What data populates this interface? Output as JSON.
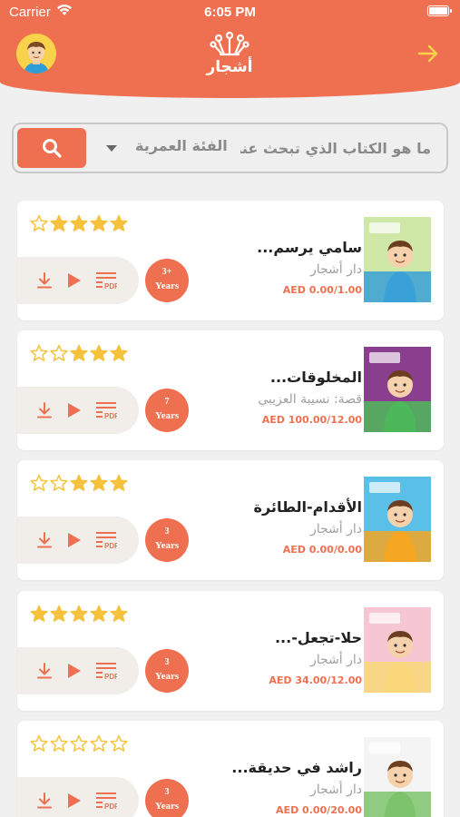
{
  "status": {
    "carrier": "Carrier",
    "time": "6:05 PM"
  },
  "header": {
    "logo_text": "أشجار"
  },
  "search": {
    "placeholder": "ما هو الكتاب الذي تبحث عنه",
    "age_filter_label": "الفئة العمرية"
  },
  "colors": {
    "accent": "#ef7050",
    "star": "#f6c23e",
    "price": "#ef7050"
  },
  "books": [
    {
      "title": "سامي يرسم...",
      "author": "دار أشجار",
      "price": "AED 0.00/1.00",
      "age_num": "3+",
      "age_unit": "Years",
      "rating": 4,
      "cover_colors": [
        "#cfe8a8",
        "#3aa0d8"
      ]
    },
    {
      "title": "المخلوقات...",
      "author": "قصة: نسيبة العزيبي",
      "price": "AED 100.00/12.00",
      "age_num": "7",
      "age_unit": "Years",
      "rating": 3,
      "cover_colors": [
        "#8a3e8e",
        "#4db85a"
      ]
    },
    {
      "title": "الأقدام-الطائرة",
      "author": "دار أشجار",
      "price": "AED 0.00/0.00",
      "age_num": "3",
      "age_unit": "Years",
      "rating": 3,
      "cover_colors": [
        "#5bc0e8",
        "#f5a623"
      ]
    },
    {
      "title": "حلا-تجعل-...",
      "author": "دار أشجار",
      "price": "AED 34.00/12.00",
      "age_num": "3",
      "age_unit": "Years",
      "rating": 5,
      "cover_colors": [
        "#f7c6d3",
        "#f9d77a"
      ]
    },
    {
      "title": "راشد في حديقة...",
      "author": "دار أشجار",
      "price": "AED 0.00/20.00",
      "age_num": "3",
      "age_unit": "Years",
      "rating": 0,
      "cover_colors": [
        "#f4f4f4",
        "#7cc36b"
      ]
    }
  ]
}
